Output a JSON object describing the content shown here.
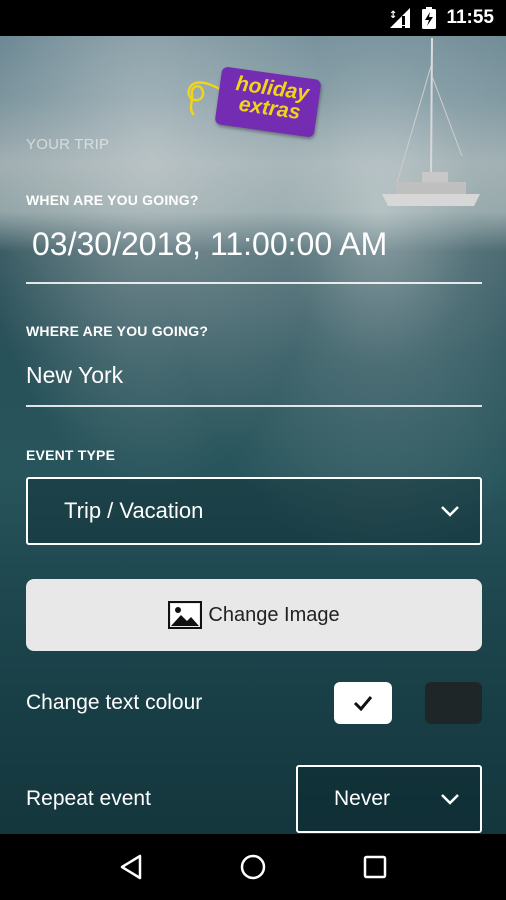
{
  "status_bar": {
    "time": "11:55",
    "icons": [
      "signal-icon",
      "battery-charging-icon"
    ]
  },
  "logo": {
    "line1": "holiday",
    "line2": "extras",
    "brand_color": "#7b2fbe",
    "text_color": "#ffe21a"
  },
  "form": {
    "section_title": "YOUR TRIP",
    "when": {
      "label": "WHEN ARE YOU GOING?",
      "value": "03/30/2018, 11:00:00 AM"
    },
    "where": {
      "label": "WHERE ARE YOU GOING?",
      "value": "New York"
    },
    "event_type": {
      "label": "EVENT TYPE",
      "selected": "Trip / Vacation"
    },
    "change_image_label": "Change Image",
    "text_colour": {
      "label": "Change text colour",
      "options": [
        "#ffffff",
        "#1f2628"
      ],
      "selected": "#ffffff"
    },
    "repeat": {
      "label": "Repeat event",
      "selected": "Never"
    }
  },
  "nav_bar": {
    "buttons": [
      "back-icon",
      "home-icon",
      "recents-icon"
    ]
  }
}
